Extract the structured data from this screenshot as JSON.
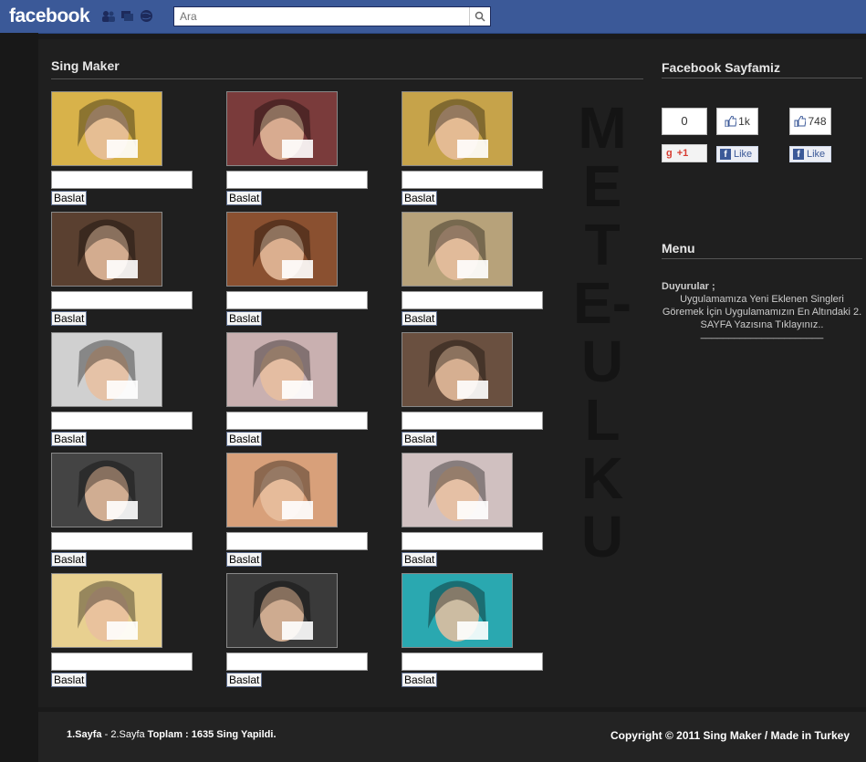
{
  "topbar": {
    "logo": "facebook",
    "search_placeholder": "Ara",
    "icons": [
      "friends-icon",
      "messages-icon",
      "notifications-globe-icon"
    ]
  },
  "main": {
    "title": "Sing Maker",
    "start_label": "Baslat",
    "watermark": "METE-ULKU",
    "items": [
      {
        "hue": "#d8b24a"
      },
      {
        "hue": "#7a3b3b"
      },
      {
        "hue": "#c6a34a"
      },
      {
        "hue": "#5a4030"
      },
      {
        "hue": "#8a5030"
      },
      {
        "hue": "#b7a27a"
      },
      {
        "hue": "#d0d0d0"
      },
      {
        "hue": "#c9b0b0"
      },
      {
        "hue": "#6a5040"
      },
      {
        "hue": "#444444"
      },
      {
        "hue": "#d8a07a"
      },
      {
        "hue": "#d0c0c0"
      },
      {
        "hue": "#e8d090"
      },
      {
        "hue": "#3a3a3a"
      },
      {
        "hue": "#2aa8b0"
      }
    ]
  },
  "sidebar": {
    "title": "Facebook Sayfamiz",
    "gplus_count": "0",
    "gplus_label": "+1",
    "like1_count": "1k",
    "like2_count": "748",
    "like_label": "Like",
    "menu_title": "Menu",
    "announce_title": "Duyurular ;",
    "announce_text": "Uygulamamıza Yeni Eklenen Singleri Göremek İçin Uygulamamızın En Altındaki 2. SAYFA Yazısına Tıklayınız..",
    "announce_divider": "______________________"
  },
  "footer": {
    "page1": "1.Sayfa",
    "sep": " - ",
    "page2": "2.Sayfa",
    "total_label": " Toplam : ",
    "total_count": "1635",
    "total_suffix": " Sing Yapildi.",
    "copyright": "Copyright © 2011 Sing Maker / Made in Turkey"
  }
}
